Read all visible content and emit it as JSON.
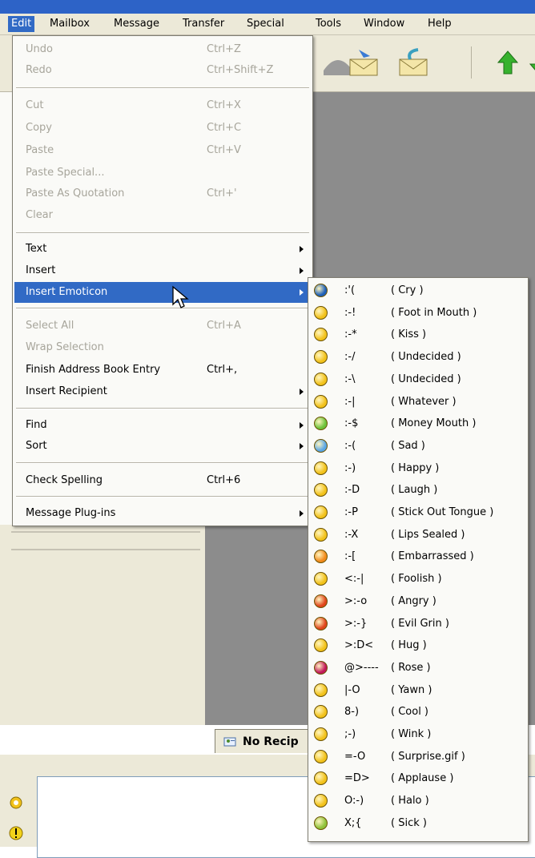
{
  "menubar": {
    "items": [
      "Edit",
      "Mailbox",
      "Message",
      "Transfer",
      "Special",
      "Tools",
      "Window",
      "Help"
    ]
  },
  "edit_menu": {
    "items": [
      {
        "label": "Undo",
        "shortcut": "Ctrl+Z",
        "enabled": false
      },
      {
        "label": "Redo",
        "shortcut": "Ctrl+Shift+Z",
        "enabled": false
      },
      {
        "label": "Cut",
        "shortcut": "Ctrl+X",
        "enabled": false
      },
      {
        "label": "Copy",
        "shortcut": "Ctrl+C",
        "enabled": false
      },
      {
        "label": "Paste",
        "shortcut": "Ctrl+V",
        "enabled": false
      },
      {
        "label": "Paste Special...",
        "shortcut": "",
        "enabled": false
      },
      {
        "label": "Paste As Quotation",
        "shortcut": "Ctrl+'",
        "enabled": false
      },
      {
        "label": "Clear",
        "shortcut": "",
        "enabled": false
      },
      {
        "label": "Text",
        "shortcut": "",
        "enabled": true,
        "submenu": true
      },
      {
        "label": "Insert",
        "shortcut": "",
        "enabled": true,
        "submenu": true
      },
      {
        "label": "Insert Emoticon",
        "shortcut": "",
        "enabled": true,
        "submenu": true,
        "highlighted": true
      },
      {
        "label": "Select All",
        "shortcut": "Ctrl+A",
        "enabled": false
      },
      {
        "label": "Wrap Selection",
        "shortcut": "",
        "enabled": false
      },
      {
        "label": "Finish Address Book Entry",
        "shortcut": "Ctrl+,",
        "enabled": true
      },
      {
        "label": "Insert Recipient",
        "shortcut": "",
        "enabled": true,
        "submenu": true
      },
      {
        "label": "Find",
        "shortcut": "",
        "enabled": true,
        "submenu": true
      },
      {
        "label": "Sort",
        "shortcut": "",
        "enabled": true,
        "submenu": true
      },
      {
        "label": "Check Spelling",
        "shortcut": "Ctrl+6",
        "enabled": true
      },
      {
        "label": "Message Plug-ins",
        "shortcut": "",
        "enabled": true,
        "submenu": true
      }
    ]
  },
  "emoticons": [
    {
      "code": ":'(",
      "desc": "( Cry )",
      "color": "#1d5fb8"
    },
    {
      "code": ":-!",
      "desc": "( Foot in Mouth )",
      "color": "#f2c21b"
    },
    {
      "code": ":-*",
      "desc": "( Kiss )",
      "color": "#f2c21b"
    },
    {
      "code": ":-/",
      "desc": "( Undecided )",
      "color": "#f2c21b"
    },
    {
      "code": ":-\\",
      "desc": "( Undecided )",
      "color": "#f2c21b"
    },
    {
      "code": ":-|",
      "desc": "( Whatever )",
      "color": "#f2c21b"
    },
    {
      "code": ":-$",
      "desc": "( Money Mouth )",
      "color": "#6cc23a"
    },
    {
      "code": ":-(",
      "desc": "( Sad )",
      "color": "#5aa6e6"
    },
    {
      "code": ":-)",
      "desc": "( Happy )",
      "color": "#f2c21b"
    },
    {
      "code": ":-D",
      "desc": "( Laugh )",
      "color": "#f2c21b"
    },
    {
      "code": ":-P",
      "desc": "( Stick Out Tongue )",
      "color": "#f2c21b"
    },
    {
      "code": ":-X",
      "desc": "( Lips Sealed )",
      "color": "#f2c21b"
    },
    {
      "code": ":-[",
      "desc": "( Embarrassed )",
      "color": "#f28a1b"
    },
    {
      "code": "<:-|",
      "desc": "( Foolish )",
      "color": "#f2c21b"
    },
    {
      "code": ">:-o",
      "desc": "( Angry )",
      "color": "#e0451b"
    },
    {
      "code": ">:-}",
      "desc": "( Evil Grin )",
      "color": "#e0451b"
    },
    {
      "code": ">:D<",
      "desc": "( Hug )",
      "color": "#f2c21b"
    },
    {
      "code": "@>----",
      "desc": "( Rose )",
      "color": "#c2185b"
    },
    {
      "code": "|-O",
      "desc": "( Yawn )",
      "color": "#f2c21b"
    },
    {
      "code": "8-)",
      "desc": "( Cool )",
      "color": "#f2c21b"
    },
    {
      "code": ";-)",
      "desc": "( Wink )",
      "color": "#f2c21b"
    },
    {
      "code": "=-O",
      "desc": "( Surprise.gif )",
      "color": "#f2c21b"
    },
    {
      "code": "=D>",
      "desc": "( Applause )",
      "color": "#f2c21b"
    },
    {
      "code": "O:-)",
      "desc": "( Halo )",
      "color": "#f2c21b"
    },
    {
      "code": "X;{",
      "desc": "( Sick )",
      "color": "#8fc23a"
    }
  ],
  "recipient_tab": {
    "label": "No Recip"
  }
}
